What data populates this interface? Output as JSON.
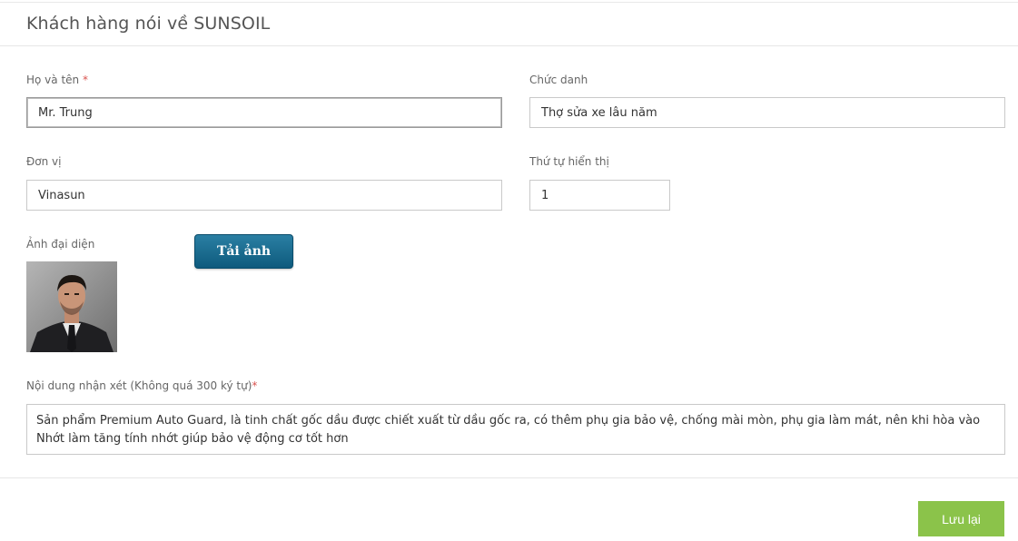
{
  "header": {
    "title": "Khách hàng nói về SUNSOIL"
  },
  "form": {
    "name": {
      "label": "Họ và tên",
      "required_mark": "*",
      "value": "Mr. Trung"
    },
    "position": {
      "label": "Chức danh",
      "value": "Thợ sửa xe lâu năm"
    },
    "organization": {
      "label": "Đơn vị",
      "value": "Vinasun"
    },
    "order": {
      "label": "Thứ tự hiển thị",
      "value": "1"
    },
    "avatar": {
      "label": "Ảnh đại diện",
      "upload_label": "Tải ảnh"
    },
    "comment": {
      "label": "Nội dung nhận xét (Không quá 300 ký tự)",
      "required_mark": "*",
      "value": "Sản phẩm Premium Auto Guard, là tinh chất gốc dầu được chiết xuất từ dầu gốc ra, có thêm phụ gia bảo vệ, chống mài mòn, phụ gia làm mát, nên khi hòa vào Nhớt làm tăng tính nhớt giúp bảo vệ động cơ tốt hơn"
    }
  },
  "footer": {
    "save_label": "Lưu lại"
  },
  "colors": {
    "save_button": "#8bc34a",
    "upload_button": "#0e5a7d",
    "required": "#d9534f"
  }
}
